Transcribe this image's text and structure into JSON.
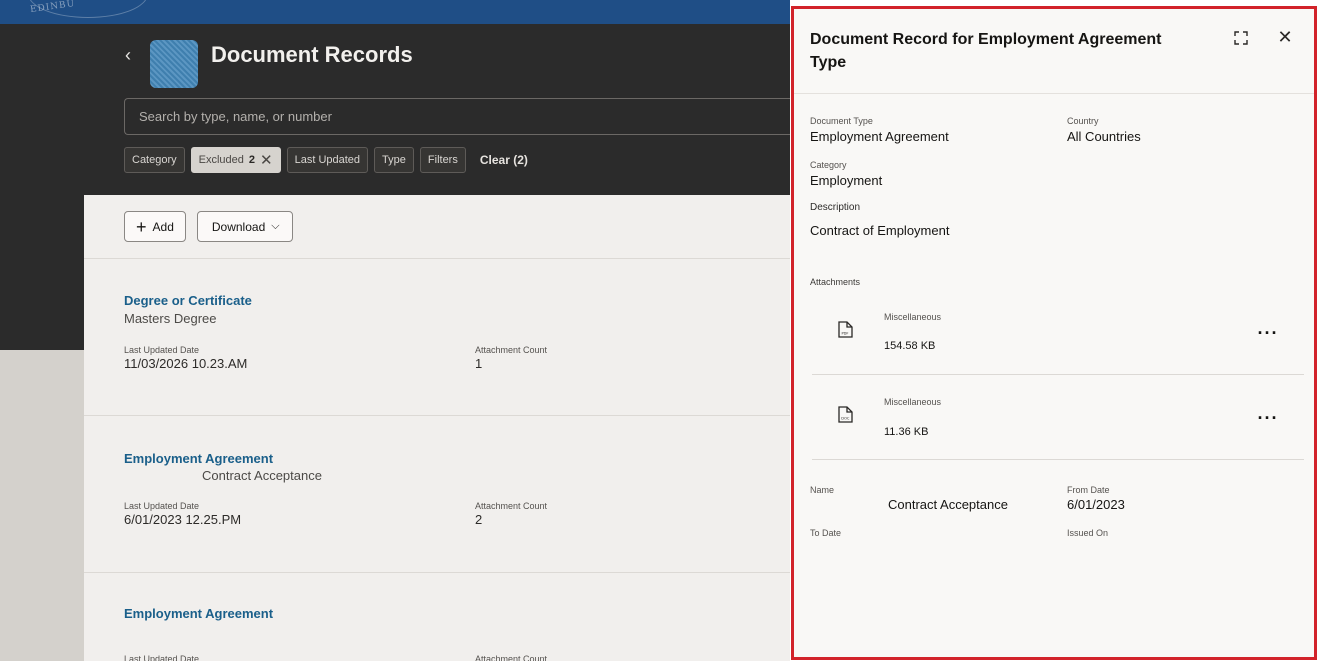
{
  "banner": {
    "seal_text": "EDINBU"
  },
  "page": {
    "title": "Document Records",
    "search_placeholder": "Search by type, name, or number"
  },
  "filters": {
    "category": "Category",
    "excluded_label": "Excluded",
    "excluded_count": "2",
    "last_updated": "Last Updated",
    "type": "Type",
    "filters": "Filters",
    "clear": "Clear (2)"
  },
  "toolbar": {
    "add_label": "Add",
    "download_label": "Download"
  },
  "labels": {
    "last_updated_date": "Last Updated Date",
    "attachment_count": "Attachment Count"
  },
  "records": [
    {
      "title": "Degree or Certificate",
      "subtitle": "Masters Degree",
      "last_updated": "11/03/2026 10.23.AM",
      "attachment_count": "1"
    },
    {
      "title": "Employment Agreement",
      "subtitle": "Contract Acceptance",
      "last_updated": "6/01/2023 12.25.PM",
      "attachment_count": "2"
    },
    {
      "title": "Employment Agreement",
      "subtitle": ""
    }
  ],
  "panel": {
    "title": "Document Record for Employment Agreement Type",
    "document_type_label": "Document Type",
    "document_type": "Employment Agreement",
    "country_label": "Country",
    "country": "All Countries",
    "category_label": "Category",
    "category": "Employment",
    "description_label": "Description",
    "description": "Contract of Employment",
    "attachments_label": "Attachments",
    "attachments": [
      {
        "type": "Miscellaneous",
        "size": "154.58 KB",
        "icon": "pdf-file-icon",
        "badge": "PDF"
      },
      {
        "type": "Miscellaneous",
        "size": "11.36 KB",
        "icon": "doc-file-icon",
        "badge": "DOC"
      }
    ],
    "name_label": "Name",
    "name": "Contract Acceptance",
    "from_date_label": "From Date",
    "from_date": "6/01/2023",
    "to_date_label": "To Date",
    "issued_on_label": "Issued On"
  },
  "colors": {
    "panel_border": "#d2232a",
    "link": "#1a5f8a",
    "header_dark": "#2b2b2b",
    "banner": "#1f4e86"
  }
}
